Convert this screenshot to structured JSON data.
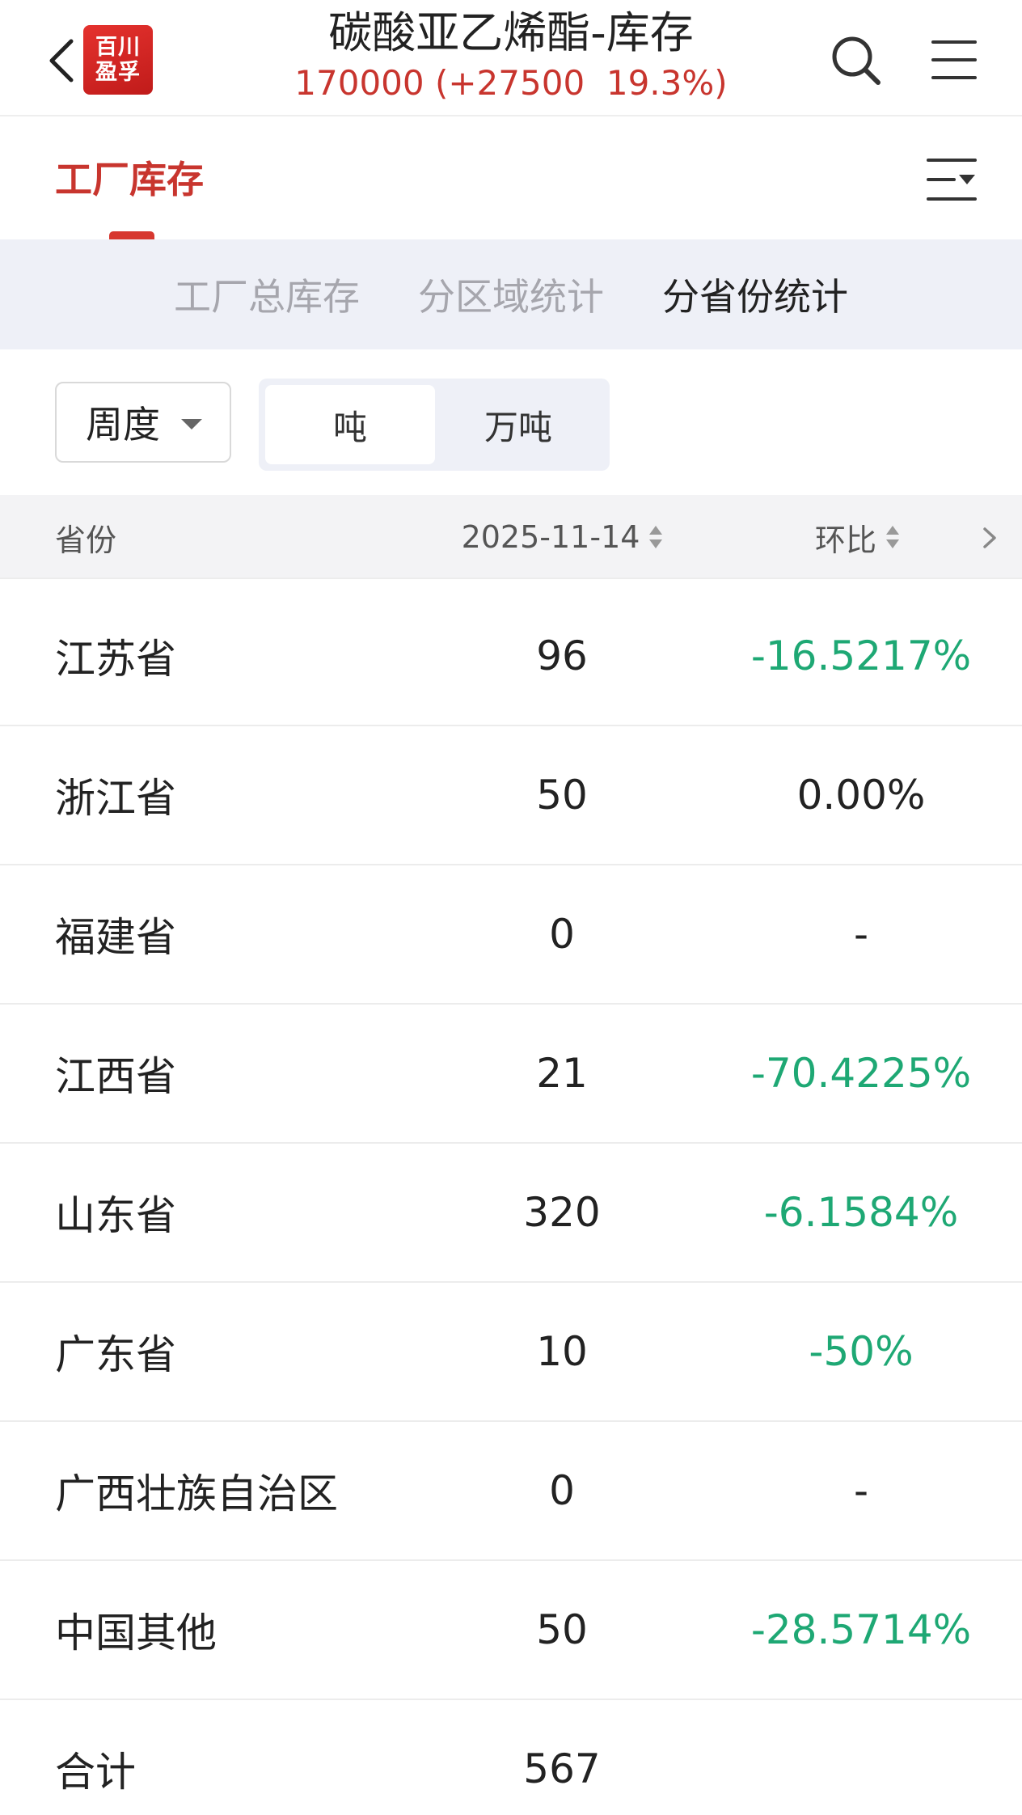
{
  "header": {
    "logo_line1": "百川",
    "logo_line2": "盈孚",
    "title": "碳酸亚乙烯酯-库存",
    "subtitle": "170000 (+27500  19.3%)"
  },
  "category": {
    "active_tab": "工厂库存"
  },
  "sub_tabs": [
    {
      "label": "工厂总库存",
      "active": false
    },
    {
      "label": "分区域统计",
      "active": false
    },
    {
      "label": "分省份统计",
      "active": true
    }
  ],
  "controls": {
    "period": "周度",
    "unit_options": [
      "吨",
      "万吨"
    ],
    "selected_unit": "吨"
  },
  "table": {
    "columns": [
      "省份",
      "2025-11-14",
      "环比"
    ],
    "rows": [
      {
        "province": "江苏省",
        "value": "96",
        "change": "-16.5217%",
        "trend": "down"
      },
      {
        "province": "浙江省",
        "value": "50",
        "change": "0.00%",
        "trend": "flat"
      },
      {
        "province": "福建省",
        "value": "0",
        "change": "-",
        "trend": "flat"
      },
      {
        "province": "江西省",
        "value": "21",
        "change": "-70.4225%",
        "trend": "down"
      },
      {
        "province": "山东省",
        "value": "320",
        "change": "-6.1584%",
        "trend": "down"
      },
      {
        "province": "广东省",
        "value": "10",
        "change": "-50%",
        "trend": "down"
      },
      {
        "province": "广西壮族自治区",
        "value": "0",
        "change": "-",
        "trend": "flat"
      },
      {
        "province": "中国其他",
        "value": "50",
        "change": "-28.5714%",
        "trend": "down"
      },
      {
        "province": "合计",
        "value": "567",
        "change": "",
        "trend": "flat"
      }
    ]
  },
  "colors": {
    "accent_red": "#c8352e",
    "down_green": "#1ea874",
    "tab_bg": "#eef0f7"
  }
}
